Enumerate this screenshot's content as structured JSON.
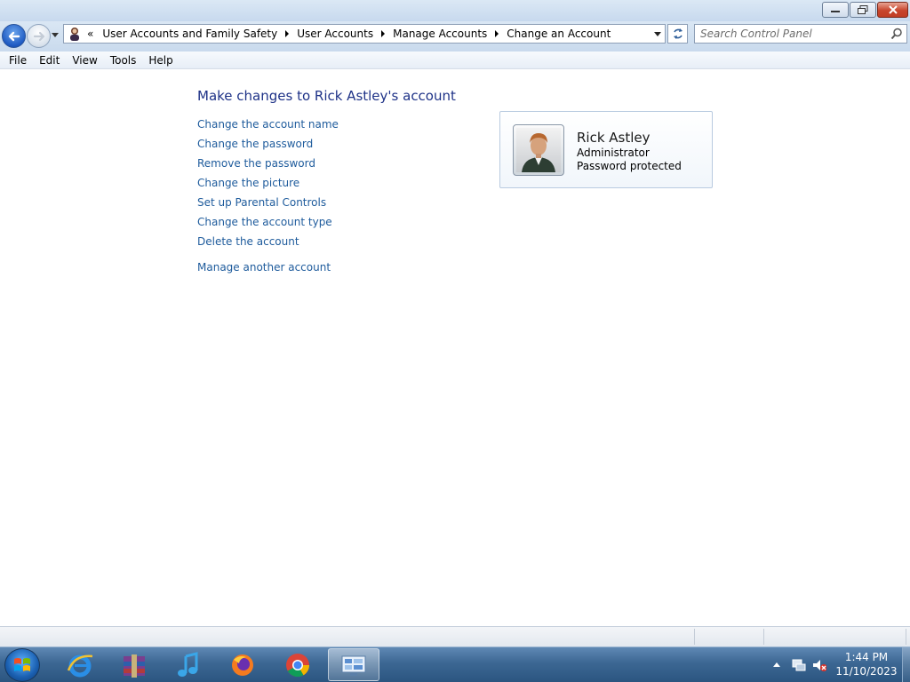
{
  "window": {
    "controls": [
      "minimize",
      "restore",
      "close"
    ]
  },
  "address_bar": {
    "overflow_glyph": "«",
    "breadcrumbs": [
      {
        "label": "User Accounts and Family Safety"
      },
      {
        "label": "User Accounts"
      },
      {
        "label": "Manage Accounts"
      },
      {
        "label": "Change an Account"
      }
    ],
    "icon": "control-panel-user-icon"
  },
  "search": {
    "placeholder": "Search Control Panel",
    "value": ""
  },
  "menu": {
    "items": [
      {
        "label": "File"
      },
      {
        "label": "Edit"
      },
      {
        "label": "View"
      },
      {
        "label": "Tools"
      },
      {
        "label": "Help"
      }
    ]
  },
  "main": {
    "title": "Make changes to Rick Astley's account",
    "tasks": [
      {
        "label": "Change the account name"
      },
      {
        "label": "Change the password"
      },
      {
        "label": "Remove the password"
      },
      {
        "label": "Change the picture"
      },
      {
        "label": "Set up Parental Controls"
      },
      {
        "label": "Change the account type"
      },
      {
        "label": "Delete the account"
      }
    ],
    "other_task": {
      "label": "Manage another account"
    }
  },
  "account": {
    "name": "Rick Astley",
    "type": "Administrator",
    "password_status": "Password protected"
  },
  "taskbar": {
    "pinned": [
      {
        "icon": "internet-explorer-icon"
      },
      {
        "icon": "winrar-icon"
      },
      {
        "icon": "itunes-icon"
      },
      {
        "icon": "firefox-icon"
      },
      {
        "icon": "chrome-icon"
      },
      {
        "icon": "control-panel-icon",
        "active": true
      }
    ],
    "clock": {
      "time": "1:44 PM",
      "date": "11/10/2023"
    }
  },
  "colors": {
    "link": "#1e5b9c",
    "title": "#1e3287",
    "taskbar": "#3c6793"
  }
}
